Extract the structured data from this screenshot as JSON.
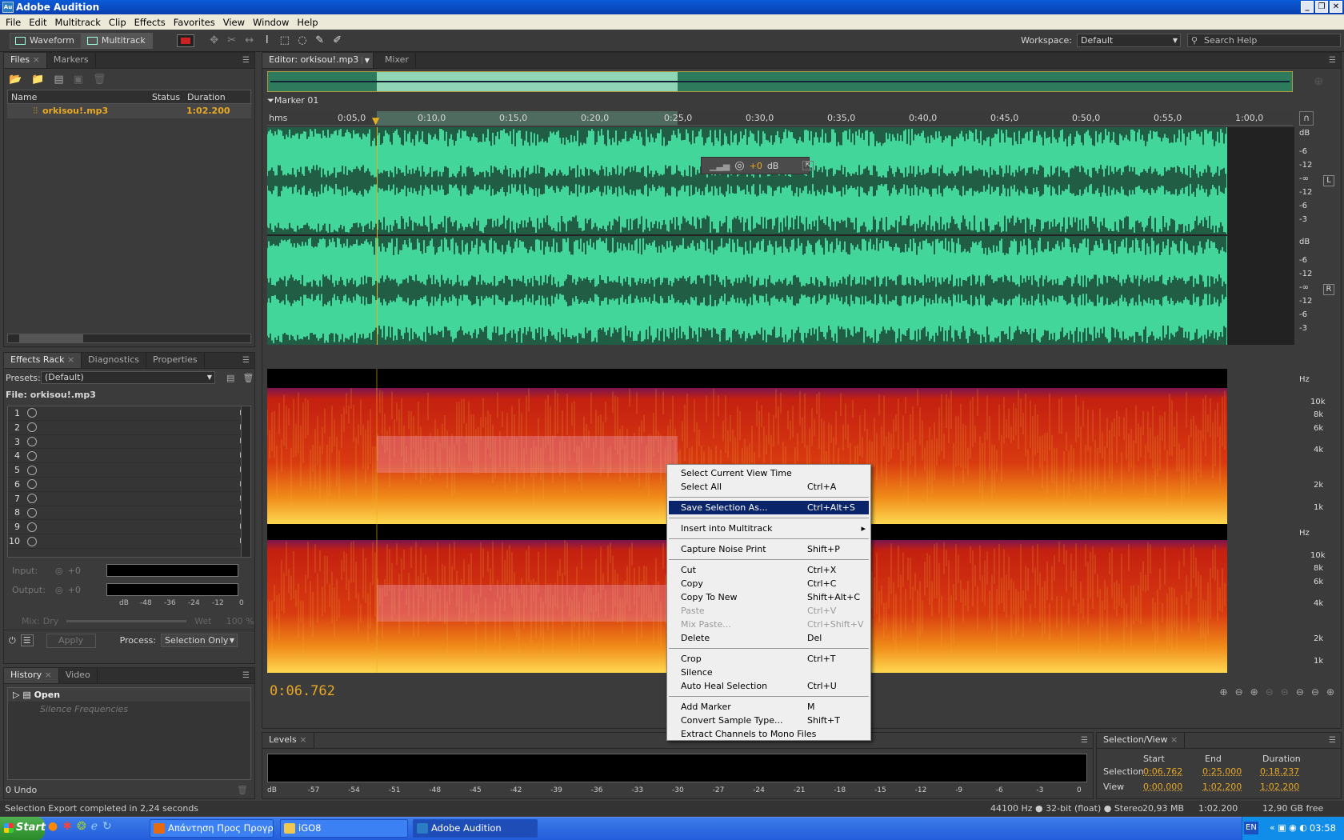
{
  "window": {
    "title": "Adobe Audition",
    "app_icon": "Au"
  },
  "menu": [
    "File",
    "Edit",
    "Multitrack",
    "Clip",
    "Effects",
    "Favorites",
    "View",
    "Window",
    "Help"
  ],
  "toolbar": {
    "waveform": "Waveform",
    "multitrack": "Multitrack",
    "workspace_label": "Workspace:",
    "workspace_value": "Default",
    "search_placeholder": "Search Help"
  },
  "files_panel": {
    "tabs": [
      "Files",
      "Markers"
    ],
    "columns": [
      "Name",
      "Status",
      "Duration"
    ],
    "file_name": "orkisou!.mp3",
    "file_duration": "1:02.200"
  },
  "effects_rack": {
    "tabs": [
      "Effects Rack",
      "Diagnostics",
      "Properties"
    ],
    "presets_label": "Presets:",
    "presets_value": "(Default)",
    "file_label": "File: orkisou!.mp3",
    "slots": [
      "1",
      "2",
      "3",
      "4",
      "5",
      "6",
      "7",
      "8",
      "9",
      "10"
    ],
    "input_label": "Input:",
    "output_label": "Output:",
    "meter_value": "+0",
    "meter_scale": [
      "dB",
      "-48",
      "-36",
      "-24",
      "-12",
      "0"
    ],
    "mix_label": "Mix:",
    "dry": "Dry",
    "wet": "Wet",
    "wet_pct": "100 %",
    "apply": "Apply",
    "process_label": "Process:",
    "process_value": "Selection Only"
  },
  "history": {
    "tabs": [
      "History",
      "Video"
    ],
    "items": [
      "Open",
      "Silence Frequencies"
    ],
    "undo": "0 Undo"
  },
  "editor": {
    "tabs": [
      "Editor: orkisou!.mp3",
      "Mixer"
    ],
    "marker": "Marker 01",
    "time_unit": "hms",
    "ruler": [
      "0:05,0",
      "0:10,0",
      "0:15,0",
      "0:20,0",
      "0:25,0",
      "0:30,0",
      "0:35,0",
      "0:40,0",
      "0:45,0",
      "0:50,0",
      "0:55,0",
      "1:00,0"
    ],
    "hud_value": "+0",
    "hud_unit": "dB",
    "db_scale": [
      "dB",
      "-6",
      "-12",
      "-∞",
      "-12",
      "-6",
      "-3"
    ],
    "channel_left": "L",
    "channel_right": "R",
    "hz_unit": "Hz",
    "hz_scale": [
      "10k",
      "8k",
      "6k",
      "4k",
      "2k",
      "1k"
    ],
    "current_time": "0:06.762"
  },
  "context_menu": [
    {
      "label": "Select Current View Time",
      "shortcut": ""
    },
    {
      "label": "Select All",
      "shortcut": "Ctrl+A"
    },
    {
      "sep": true
    },
    {
      "label": "Save Selection As...",
      "shortcut": "Ctrl+Alt+S",
      "selected": true
    },
    {
      "sep": true
    },
    {
      "label": "Insert into Multitrack",
      "shortcut": "",
      "submenu": true
    },
    {
      "sep": true
    },
    {
      "label": "Capture Noise Print",
      "shortcut": "Shift+P"
    },
    {
      "sep": true
    },
    {
      "label": "Cut",
      "shortcut": "Ctrl+X"
    },
    {
      "label": "Copy",
      "shortcut": "Ctrl+C"
    },
    {
      "label": "Copy To New",
      "shortcut": "Shift+Alt+C"
    },
    {
      "label": "Paste",
      "shortcut": "Ctrl+V",
      "disabled": true
    },
    {
      "label": "Mix Paste...",
      "shortcut": "Ctrl+Shift+V",
      "disabled": true
    },
    {
      "label": "Delete",
      "shortcut": "Del"
    },
    {
      "sep": true
    },
    {
      "label": "Crop",
      "shortcut": "Ctrl+T"
    },
    {
      "label": "Silence",
      "shortcut": ""
    },
    {
      "label": "Auto Heal Selection",
      "shortcut": "Ctrl+U"
    },
    {
      "sep": true
    },
    {
      "label": "Add Marker",
      "shortcut": "M"
    },
    {
      "label": "Convert Sample Type...",
      "shortcut": "Shift+T"
    },
    {
      "label": "Extract Channels to Mono Files",
      "shortcut": ""
    }
  ],
  "levels": {
    "tab": "Levels",
    "scale": [
      "dB",
      "-57",
      "-54",
      "-51",
      "-48",
      "-45",
      "-42",
      "-39",
      "-36",
      "-33",
      "-30",
      "-27",
      "-24",
      "-21",
      "-18",
      "-15",
      "-12",
      "-9",
      "-6",
      "-3",
      "0"
    ]
  },
  "selection_view": {
    "tab": "Selection/View",
    "headers": [
      "Start",
      "End",
      "Duration"
    ],
    "rows": [
      {
        "label": "Selection",
        "start": "0:06.762",
        "end": "0:25.000",
        "duration": "0:18.237"
      },
      {
        "label": "View",
        "start": "0:00.000",
        "end": "1:02.200",
        "duration": "1:02.200"
      }
    ]
  },
  "status": {
    "message": "Selection Export completed in 2,24 seconds",
    "format": "44100 Hz ● 32-bit (float) ● Stereo",
    "size": "20,93 MB",
    "duration": "1:02.200",
    "free": "12,90 GB free"
  },
  "taskbar": {
    "start": "Start",
    "tasks": [
      "Απάντηση Προς Προγρα...",
      "iGO8",
      "Adobe Audition"
    ],
    "lang": "EN",
    "clock": "03:58"
  }
}
